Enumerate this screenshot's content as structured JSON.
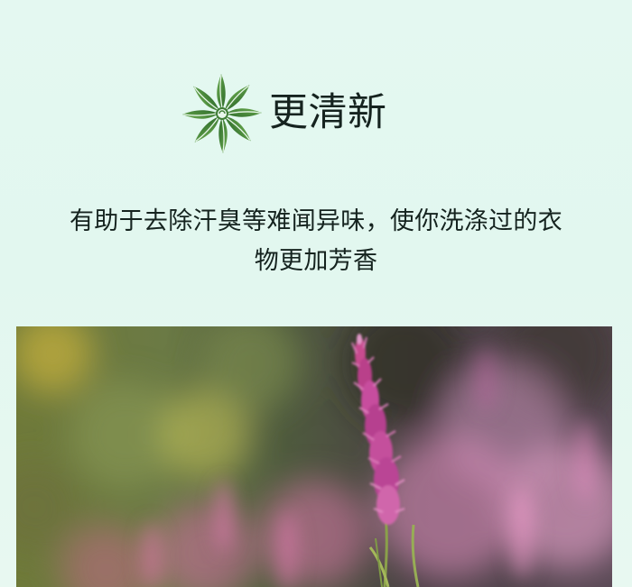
{
  "header": {
    "logo_icon": "star-anise-icon",
    "title": "更清新"
  },
  "description": {
    "line1": "有助于去除汗臭等难闻异味，使你洗涤过的衣",
    "line2": "物更加芳香"
  },
  "photo": {
    "subject": "pink-flower-spike-image"
  },
  "colors": {
    "background": "#e4f8f1",
    "logo_dark": "#2f6b2f",
    "logo_light": "#5fa04a",
    "text": "#15231f",
    "flower": "#c74e9e"
  }
}
